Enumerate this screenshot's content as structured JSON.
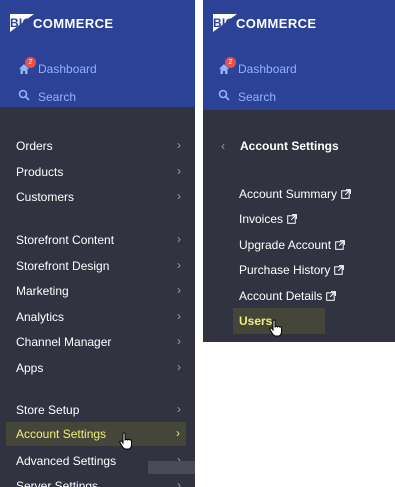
{
  "left_panel": {
    "logo_big": "BIG",
    "logo_commerce": "COMMERCE",
    "dashboard_label": "Dashboard",
    "dashboard_badge": "2",
    "search_label": "Search",
    "items": [
      {
        "label": "Orders"
      },
      {
        "label": "Products"
      },
      {
        "label": "Customers"
      },
      {
        "label": "Storefront Content"
      },
      {
        "label": "Storefront Design"
      },
      {
        "label": "Marketing"
      },
      {
        "label": "Analytics"
      },
      {
        "label": "Channel Manager"
      },
      {
        "label": "Apps"
      },
      {
        "label": "Store Setup"
      },
      {
        "label": "Account Settings"
      },
      {
        "label": "Advanced Settings"
      },
      {
        "label": "Server Settings"
      }
    ],
    "chevron": "›"
  },
  "right_panel": {
    "logo_big": "BIG",
    "logo_commerce": "COMMERCE",
    "dashboard_label": "Dashboard",
    "dashboard_badge": "2",
    "search_label": "Search",
    "back_arrow": "‹",
    "title": "Account Settings",
    "items": [
      {
        "label": "Account Summary"
      },
      {
        "label": "Invoices"
      },
      {
        "label": "Upgrade Account"
      },
      {
        "label": "Purchase History"
      },
      {
        "label": "Account Details"
      },
      {
        "label": "Users"
      }
    ]
  },
  "colors": {
    "header_blue": "#2b4296",
    "sidebar_dark": "#313440",
    "highlight": "#eaf07a",
    "link_blue": "#8fb3ff",
    "badge_red": "#e8504c"
  }
}
